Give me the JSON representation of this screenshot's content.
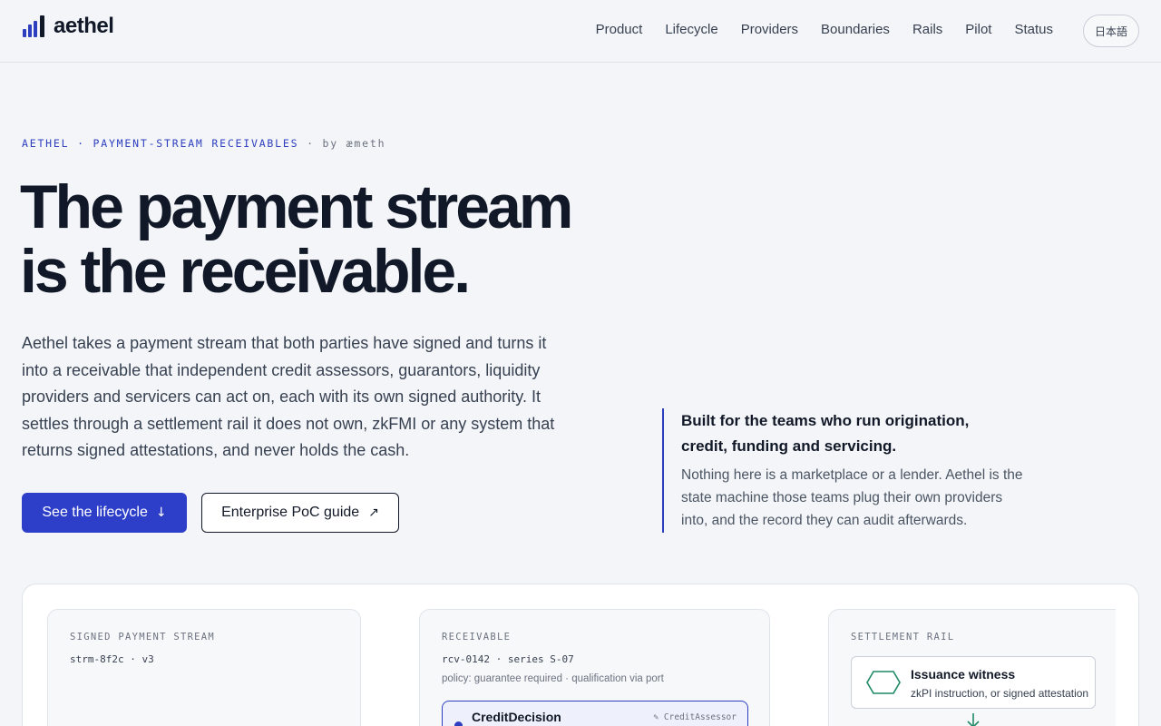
{
  "header": {
    "logo_text": "aethel",
    "nav": [
      "Product",
      "Lifecycle",
      "Providers",
      "Boundaries",
      "Rails",
      "Pilot",
      "Status"
    ],
    "lang_button": "日本語"
  },
  "hero": {
    "eyebrow_main": "AETHEL · PAYMENT-STREAM RECEIVABLES",
    "eyebrow_by": "· by æmeth",
    "title_line1": "The payment stream",
    "title_line2": "is the receivable.",
    "description": "Aethel takes a payment stream that both parties have signed and turns it into a receivable that independent credit assessors, guarantors, liquidity providers and servicers can act on, each with its own signed authority. It settles through a settlement rail it does not own, zkFMI or any system that returns signed attestations, and never holds the cash.",
    "primary_cta": "See the lifecycle",
    "secondary_cta": "Enterprise PoC guide"
  },
  "aside": {
    "title": "Built for the teams who run origination, credit, funding and servicing.",
    "body": "Nothing here is a marketplace or a lender. Aethel is the state machine those teams plug their own providers into, and the record they can audit afterwards."
  },
  "panel": {
    "stream": {
      "label": "SIGNED PAYMENT STREAM",
      "id": "strm-8f2c · v3"
    },
    "receivable": {
      "label": "RECEIVABLE",
      "id": "rcv-0142 · series S-07",
      "policy": "policy: guarantee required · qualification via port",
      "decision_title": "CreditDecision",
      "decision_role": "✎ CreditAssessor"
    },
    "rail": {
      "label": "SETTLEMENT RAIL",
      "witness_title": "Issuance witness",
      "witness_sub": "zkPI instruction, or signed attestation"
    }
  },
  "colors": {
    "accent": "#2d3fc8",
    "rail_icon": "#1f8a63"
  }
}
